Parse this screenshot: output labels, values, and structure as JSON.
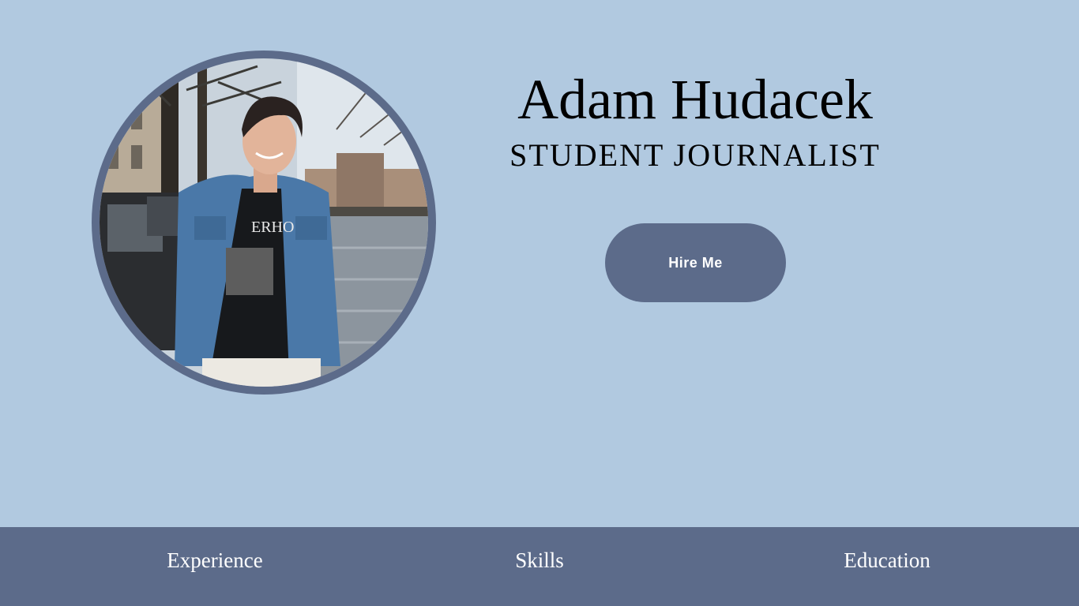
{
  "profile": {
    "name": "Adam Hudacek",
    "role": "STUDENT JOURNALIST",
    "photo_icon": "portrait-photo"
  },
  "actions": {
    "hire_label": "Hire Me"
  },
  "nav": {
    "items": [
      {
        "label": "Experience"
      },
      {
        "label": "Skills"
      },
      {
        "label": "Education"
      }
    ]
  },
  "colors": {
    "background": "#b1c9e0",
    "accent": "#5c6b8a",
    "text": "#000000",
    "nav_text": "#ffffff"
  }
}
